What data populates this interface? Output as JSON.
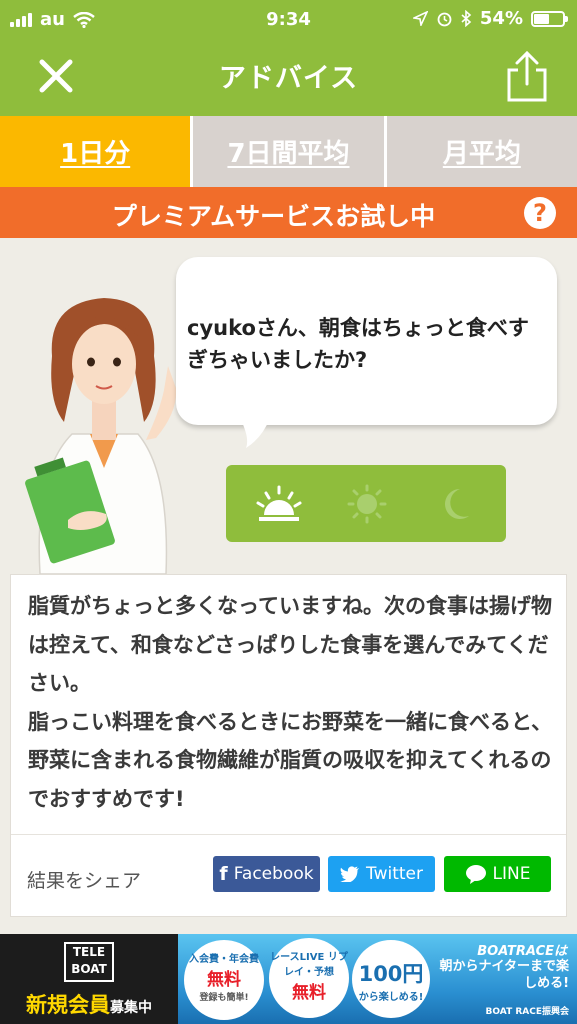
{
  "status": {
    "carrier": "au",
    "time": "9:34",
    "battery": "54%",
    "battery_level": 0.54
  },
  "nav": {
    "title": "アドバイス",
    "close_icon": "close-icon",
    "share_icon": "share-icon"
  },
  "tabs": [
    {
      "label": "1日分",
      "active": true
    },
    {
      "label": "7日間平均",
      "active": false
    },
    {
      "label": "月平均",
      "active": false
    }
  ],
  "premium": {
    "label": "プレミアムサービスお試し中",
    "help": "?"
  },
  "bubble": {
    "text": "cyukoさん、朝食はちょっと食べすぎちゃいましたか?"
  },
  "meals": [
    {
      "icon": "sunrise-icon",
      "active": true
    },
    {
      "icon": "sun-icon",
      "active": false
    },
    {
      "icon": "moon-icon",
      "active": false
    }
  ],
  "advice": {
    "para1": "脂質がちょっと多くなっていますね。次の食事は揚げ物は控えて、和食などさっぱりした食事を選んでみてください。",
    "para2": "脂っこい料理を食べるときにお野菜を一緒に食べると、野菜に含まれる食物繊維が脂質の吸収を抑えてくれるのでおすすめです!"
  },
  "share": {
    "label": "結果をシェア",
    "facebook": "Facebook",
    "twitter": "Twitter",
    "line": "LINE"
  },
  "banner": {
    "teleboat_logo_line1": "TELE",
    "teleboat_logo_line2": "BOAT",
    "teleboat_cta": "新規会員",
    "teleboat_cta_small": "募集中",
    "b1_small": "入会費・年会費",
    "b1_large": "無料",
    "b1_note": "登録も簡単!",
    "b2_small": "レースLIVE リプレイ・予想",
    "b2_large": "無料",
    "b3_large": "100円",
    "b3_note": "から楽しめる!",
    "title": "BOATRACEは",
    "subtitle": "朝からナイターまで楽しめる!",
    "footer": "BOAT RACE振興会"
  }
}
